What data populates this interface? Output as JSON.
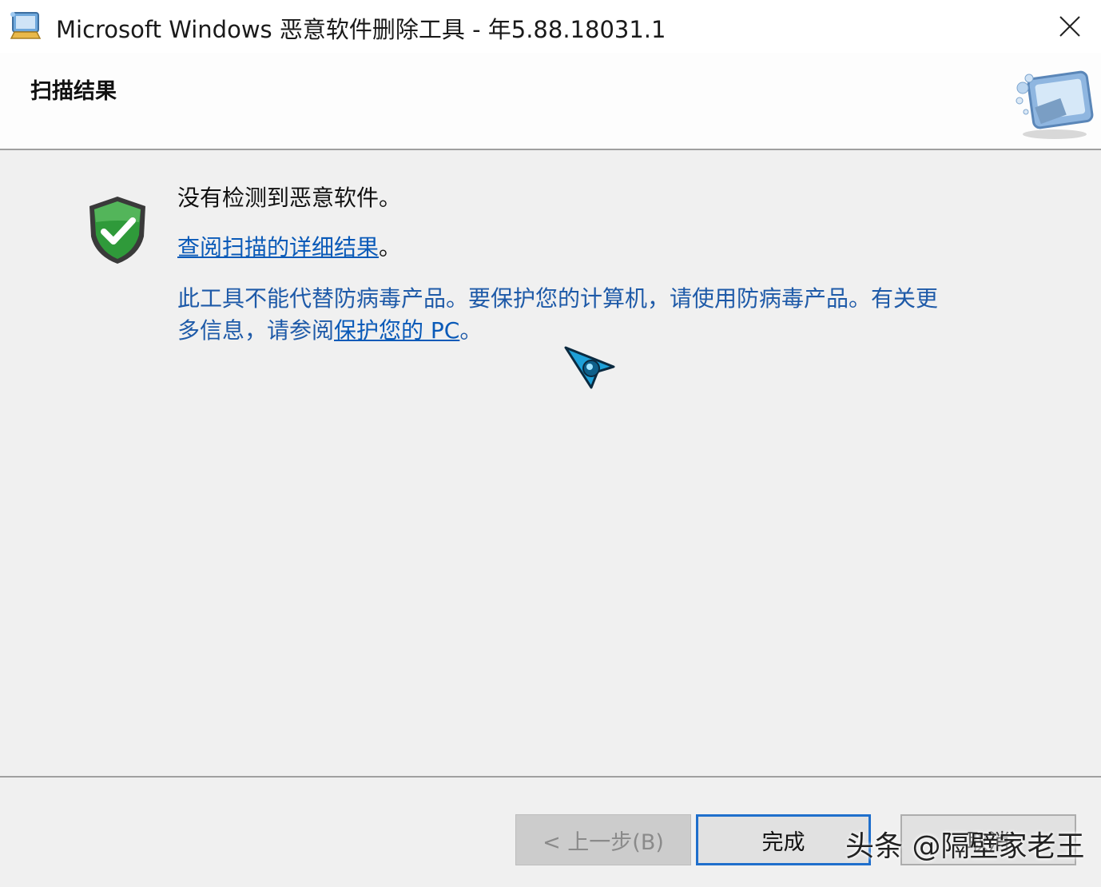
{
  "window": {
    "title": "Microsoft Windows 恶意软件删除工具 - 年5.88.18031.1",
    "app_icon": "msrt-app-icon",
    "close_icon": "close-icon"
  },
  "header": {
    "title": "扫描结果",
    "logo_icon": "msrt-computer-logo-icon"
  },
  "main": {
    "status_icon": "green-shield-check-icon",
    "status_text": "没有检测到恶意软件。",
    "details_link": "查阅扫描的详细结果",
    "details_suffix": "。",
    "info_line1": "此工具不能代替防病毒产品。要保护您的计算机，请使用防病毒产品。有关更",
    "info_line2_prefix": "多信息，请参阅",
    "info_link": "保护您的 PC",
    "info_suffix": "。",
    "cursor_icon": "busy-pointer-icon"
  },
  "footer": {
    "back_label": "< 上一步(B)",
    "finish_label": "完成",
    "cancel_label": "取消"
  },
  "watermark": "头条 @隔壁家老王",
  "colors": {
    "link": "#0a5ab8",
    "info_text": "#1e5aa8",
    "focus_border": "#1f6fcc",
    "background": "#f0f0f0"
  }
}
